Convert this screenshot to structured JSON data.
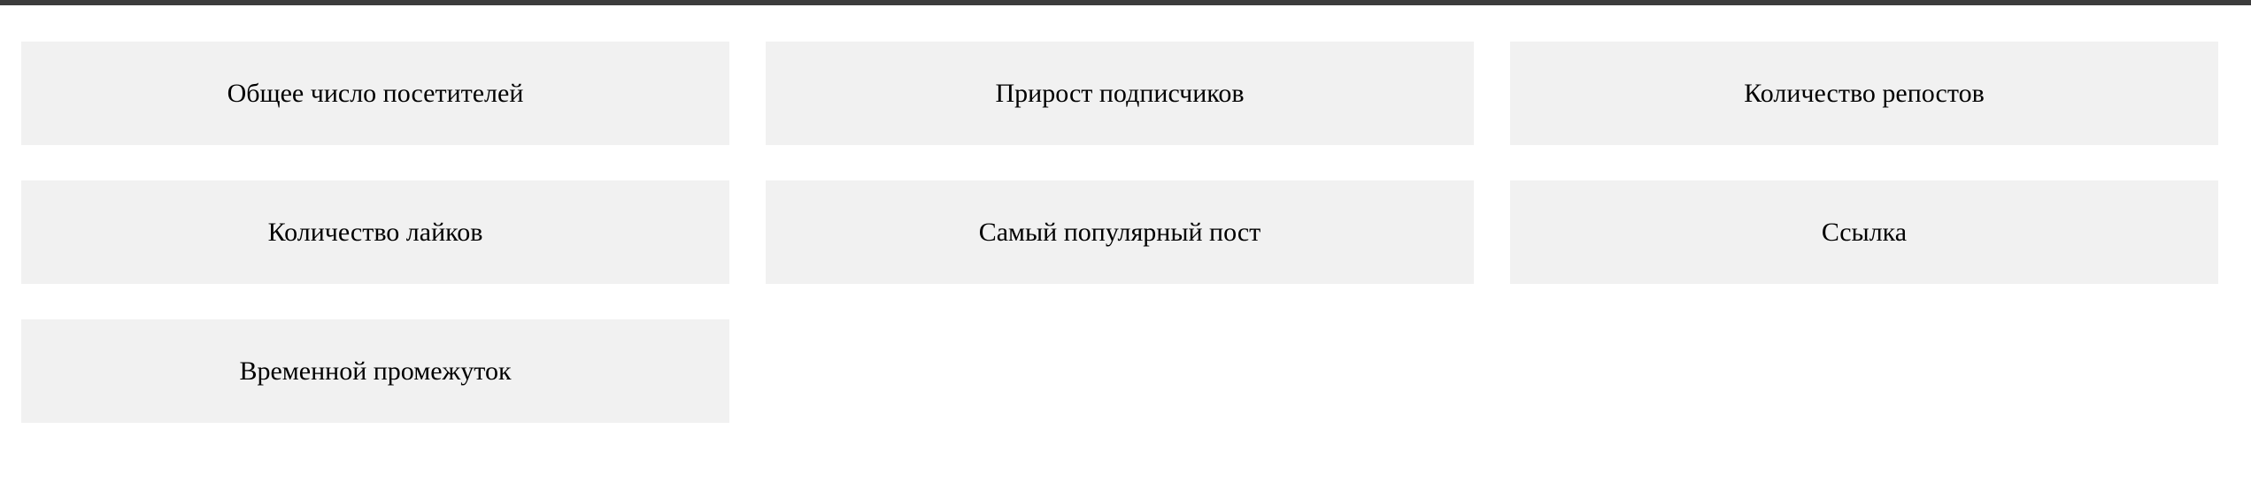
{
  "cards": [
    {
      "label": "Общее число посетителей"
    },
    {
      "label": "Прирост подписчиков"
    },
    {
      "label": "Количество репостов"
    },
    {
      "label": "Количество лайков"
    },
    {
      "label": "Самый популярный пост"
    },
    {
      "label": "Ссылка"
    },
    {
      "label": "Временной промежуток"
    }
  ],
  "colors": {
    "topbar": "#3c3c3c",
    "card_bg": "#f1f1f1"
  }
}
